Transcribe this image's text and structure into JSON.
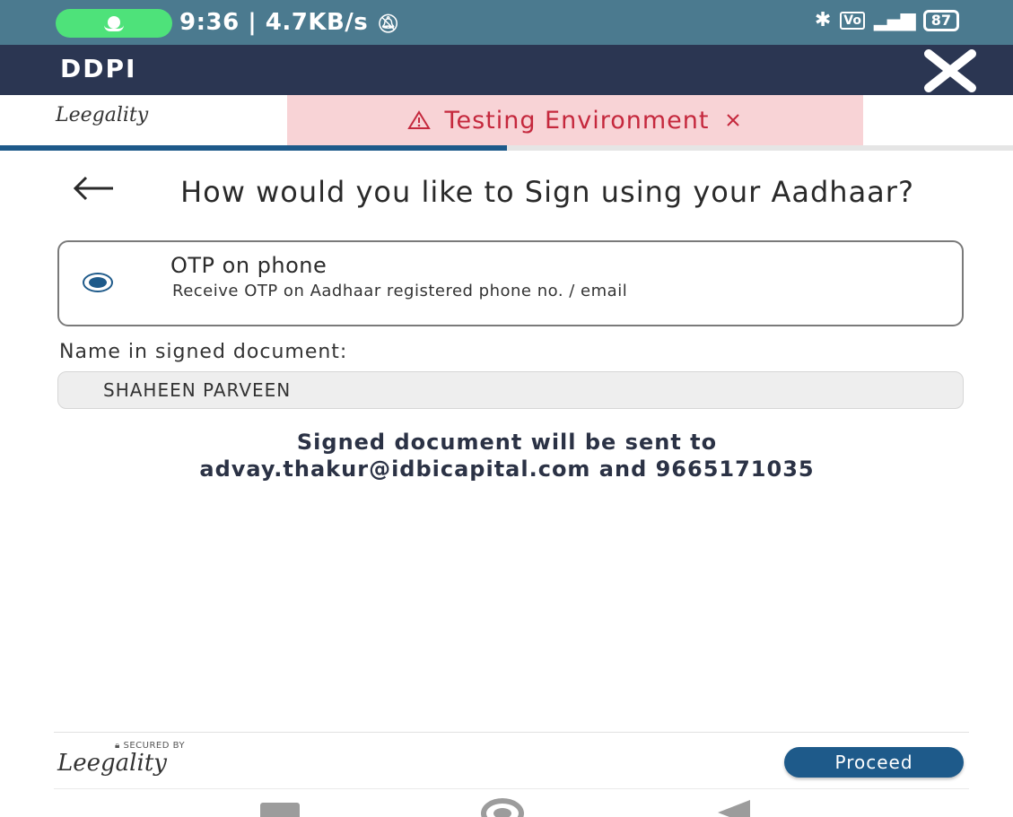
{
  "status_bar": {
    "time_speed": "9:36 | 4.7KB/s",
    "battery": "87",
    "icons": [
      "mic-icon",
      "mute-icon",
      "bluetooth-icon",
      "volte-icon",
      "signal-icon",
      "battery-icon"
    ]
  },
  "app_bar": {
    "title": "DDPI",
    "close_icon": "close-icon"
  },
  "header": {
    "logo_text": "Leegality",
    "banner_text": "Testing Environment",
    "progress_fraction": 0.5
  },
  "question": {
    "text": "How would you like to Sign using your Aadhaar?"
  },
  "option": {
    "title": "OTP on phone",
    "subtitle": "Receive OTP on Aadhaar registered phone no. / email",
    "selected": true
  },
  "name": {
    "label": "Name in signed document:",
    "value": "SHAHEEN PARVEEN"
  },
  "note": {
    "line1": "Signed document will be sent to",
    "line2": "advay.thakur@idbicapital.com and 9665171035"
  },
  "footer": {
    "secured_label": "SECURED BY",
    "logo_text": "Leegality",
    "proceed_label": "Proceed"
  },
  "colors": {
    "status_bar": "#4b7a8f",
    "app_bar": "#2b3652",
    "banner_bg": "#f8d3d6",
    "banner_text": "#c5283d",
    "accent": "#1e5a8a"
  }
}
